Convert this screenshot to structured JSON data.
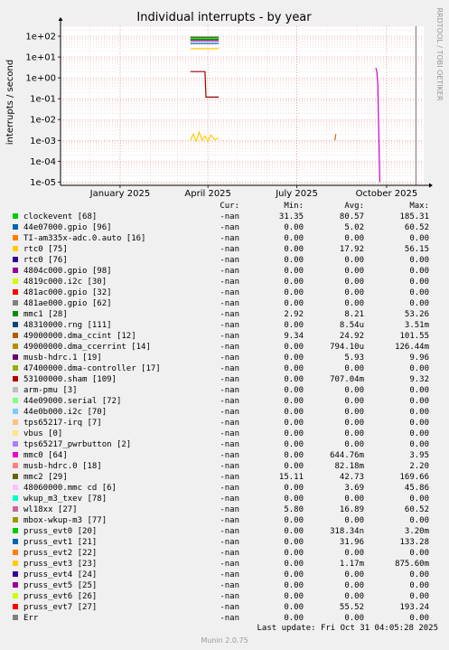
{
  "chart_data": {
    "type": "line",
    "title": "Individual interrupts - by year",
    "ylabel": "interrupts / second",
    "yscale": "log",
    "ylim": [
      7e-06,
      300
    ],
    "yticks": [
      {
        "v": 100,
        "label": "1e+02"
      },
      {
        "v": 10,
        "label": "1e+01"
      },
      {
        "v": 1,
        "label": "1e+00"
      },
      {
        "v": 0.1,
        "label": "1e-01"
      },
      {
        "v": 0.01,
        "label": "1e-02"
      },
      {
        "v": 0.001,
        "label": "1e-03"
      },
      {
        "v": 0.0001,
        "label": "1e-04"
      },
      {
        "v": 1e-05,
        "label": "1e-05"
      }
    ],
    "xlim": [
      "2024-11-01",
      "2025-11-08"
    ],
    "xticks": [
      {
        "d": "2025-01-01",
        "label": "January 2025"
      },
      {
        "d": "2025-04-01",
        "label": "April 2025"
      },
      {
        "d": "2025-07-01",
        "label": "July 2025"
      },
      {
        "d": "2025-10-01",
        "label": "October 2025"
      }
    ],
    "current_date": "2025-10-31",
    "grid": true,
    "side_text": "RRDTOOL / TOBI OETIKER",
    "series": [
      {
        "name": "clockevent [68]",
        "color": "#00cc00",
        "points": [
          [
            "2025-03-14",
            80
          ],
          [
            "2025-04-12",
            80
          ]
        ]
      },
      {
        "name": "44e07000.gpio [96]",
        "color": "#0066b3",
        "points": [
          [
            "2025-03-14",
            45
          ],
          [
            "2025-04-12",
            45
          ]
        ]
      },
      {
        "name": "rtc0 [75]",
        "color": "#ffcc00",
        "points": [
          [
            "2025-03-14",
            25
          ],
          [
            "2025-04-12",
            25
          ]
        ]
      },
      {
        "name": "mmc1 [28]",
        "color": "#008f00",
        "points": [
          [
            "2025-03-14",
            70
          ],
          [
            "2025-04-12",
            70
          ]
        ]
      },
      {
        "name": "musb-hdrc.1 [19]",
        "color": "#990099",
        "points": [
          [
            "2025-03-14",
            60
          ],
          [
            "2025-04-12",
            60
          ]
        ]
      },
      {
        "name": "mmc2 [29]",
        "color": "#336600",
        "points": [
          [
            "2025-03-14",
            90
          ],
          [
            "2025-04-12",
            90
          ]
        ]
      },
      {
        "name": "53100000.sham [109]",
        "color": "#990000",
        "points": [
          [
            "2025-03-14",
            2
          ],
          [
            "2025-03-29",
            2
          ],
          [
            "2025-03-30",
            0.12
          ],
          [
            "2025-04-12",
            0.12
          ]
        ]
      },
      {
        "name": "pruss_evt3 [23]",
        "color": "#ffcc00",
        "points": [
          [
            "2025-03-14",
            0.001
          ],
          [
            "2025-03-17",
            0.002
          ],
          [
            "2025-03-20",
            0.0009
          ],
          [
            "2025-03-23",
            0.0025
          ],
          [
            "2025-03-26",
            0.001
          ],
          [
            "2025-03-29",
            0.0016
          ],
          [
            "2025-04-01",
            0.0009
          ],
          [
            "2025-04-04",
            0.0018
          ],
          [
            "2025-04-08",
            0.0011
          ],
          [
            "2025-04-12",
            0.0013
          ]
        ]
      },
      {
        "name": "mmc0 [64]",
        "color": "#cc00cc",
        "points": [
          [
            "2025-09-20",
            3
          ],
          [
            "2025-09-21",
            2
          ],
          [
            "2025-09-22",
            0.5
          ],
          [
            "2025-09-23",
            0.002
          ],
          [
            "2025-09-24",
            1e-05
          ]
        ]
      },
      {
        "name": "49000000.dma_ccint [12]",
        "color": "#cc6600",
        "points": [
          [
            "2025-08-09",
            0.001
          ],
          [
            "2025-08-10",
            0.002
          ]
        ]
      }
    ]
  },
  "legend": {
    "header": {
      "cur": "Cur:",
      "min": "Min:",
      "avg": "Avg:",
      "max": "Max:"
    },
    "rows": [
      {
        "name": "clockevent [68]",
        "color": "#00cc00",
        "cur": "-nan",
        "min": "31.35",
        "avg": "80.57",
        "max": "185.31"
      },
      {
        "name": "44e07000.gpio [96]",
        "color": "#0066b3",
        "cur": "-nan",
        "min": "0.00",
        "avg": "5.02",
        "max": "60.52"
      },
      {
        "name": "TI-am335x-adc.0.auto [16]",
        "color": "#ff8000",
        "cur": "-nan",
        "min": "0.00",
        "avg": "0.00",
        "max": "0.00"
      },
      {
        "name": "rtc0 [75]",
        "color": "#ffcc00",
        "cur": "-nan",
        "min": "0.00",
        "avg": "17.92",
        "max": "56.15"
      },
      {
        "name": "rtc0 [76]",
        "color": "#330099",
        "cur": "-nan",
        "min": "0.00",
        "avg": "0.00",
        "max": "0.00"
      },
      {
        "name": "4804c000.gpio [98]",
        "color": "#990099",
        "cur": "-nan",
        "min": "0.00",
        "avg": "0.00",
        "max": "0.00"
      },
      {
        "name": "4819c000.i2c [30]",
        "color": "#ccff00",
        "cur": "-nan",
        "min": "0.00",
        "avg": "0.00",
        "max": "0.00"
      },
      {
        "name": "481ac000.gpio [32]",
        "color": "#ff0000",
        "cur": "-nan",
        "min": "0.00",
        "avg": "0.00",
        "max": "0.00"
      },
      {
        "name": "481ae000.gpio [62]",
        "color": "#808080",
        "cur": "-nan",
        "min": "0.00",
        "avg": "0.00",
        "max": "0.00"
      },
      {
        "name": "mmc1 [28]",
        "color": "#008f00",
        "cur": "-nan",
        "min": "2.92",
        "avg": "8.21",
        "max": "53.26"
      },
      {
        "name": "48310000.rng [111]",
        "color": "#00487d",
        "cur": "-nan",
        "min": "0.00",
        "avg": "8.54u",
        "max": "3.51m"
      },
      {
        "name": "49000000.dma_ccint [12]",
        "color": "#b35a00",
        "cur": "-nan",
        "min": "9.34",
        "avg": "24.92",
        "max": "101.55"
      },
      {
        "name": "49000000.dma_ccerrint [14]",
        "color": "#b38f00",
        "cur": "-nan",
        "min": "0.00",
        "avg": "794.10u",
        "max": "126.44m"
      },
      {
        "name": "musb-hdrc.1 [19]",
        "color": "#6b006b",
        "cur": "-nan",
        "min": "0.00",
        "avg": "5.93",
        "max": "9.96"
      },
      {
        "name": "47400000.dma-controller [17]",
        "color": "#8fb300",
        "cur": "-nan",
        "min": "0.00",
        "avg": "0.00",
        "max": "0.00"
      },
      {
        "name": "53100000.sham [109]",
        "color": "#b30000",
        "cur": "-nan",
        "min": "0.00",
        "avg": "707.04m",
        "max": "9.32"
      },
      {
        "name": "arm-pmu [3]",
        "color": "#bebebe",
        "cur": "-nan",
        "min": "0.00",
        "avg": "0.00",
        "max": "0.00"
      },
      {
        "name": "44e09000.serial [72]",
        "color": "#80ff80",
        "cur": "-nan",
        "min": "0.00",
        "avg": "0.00",
        "max": "0.00"
      },
      {
        "name": "44e0b000.i2c [70]",
        "color": "#80c9ff",
        "cur": "-nan",
        "min": "0.00",
        "avg": "0.00",
        "max": "0.00"
      },
      {
        "name": "tps65217-irq [7]",
        "color": "#ffc080",
        "cur": "-nan",
        "min": "0.00",
        "avg": "0.00",
        "max": "0.00"
      },
      {
        "name": "vbus [0]",
        "color": "#ffe680",
        "cur": "-nan",
        "min": "0.00",
        "avg": "0.00",
        "max": "0.00"
      },
      {
        "name": "tps65217_pwrbutton [2]",
        "color": "#aa80ff",
        "cur": "-nan",
        "min": "0.00",
        "avg": "0.00",
        "max": "0.00"
      },
      {
        "name": "mmc0 [64]",
        "color": "#ee00cc",
        "cur": "-nan",
        "min": "0.00",
        "avg": "644.76m",
        "max": "3.95"
      },
      {
        "name": "musb-hdrc.0 [18]",
        "color": "#ff8080",
        "cur": "-nan",
        "min": "0.00",
        "avg": "82.18m",
        "max": "2.20"
      },
      {
        "name": "mmc2 [29]",
        "color": "#666600",
        "cur": "-nan",
        "min": "15.11",
        "avg": "42.73",
        "max": "169.66"
      },
      {
        "name": "48060000.mmc cd [6]",
        "color": "#ffbfff",
        "cur": "-nan",
        "min": "0.00",
        "avg": "3.69",
        "max": "45.86"
      },
      {
        "name": "wkup_m3_txev [78]",
        "color": "#00ffcc",
        "cur": "-nan",
        "min": "0.00",
        "avg": "0.00",
        "max": "0.00"
      },
      {
        "name": "wl18xx [27]",
        "color": "#cc6699",
        "cur": "-nan",
        "min": "5.80",
        "avg": "16.89",
        "max": "60.52"
      },
      {
        "name": "mbox-wkup-m3 [77]",
        "color": "#999900",
        "cur": "-nan",
        "min": "0.00",
        "avg": "0.00",
        "max": "0.00"
      },
      {
        "name": "pruss_evt0 [20]",
        "color": "#00cc00",
        "cur": "-nan",
        "min": "0.00",
        "avg": "318.34n",
        "max": "3.20m"
      },
      {
        "name": "pruss_evt1 [21]",
        "color": "#0066b3",
        "cur": "-nan",
        "min": "0.00",
        "avg": "31.96",
        "max": "133.28"
      },
      {
        "name": "pruss_evt2 [22]",
        "color": "#ff8000",
        "cur": "-nan",
        "min": "0.00",
        "avg": "0.00",
        "max": "0.00"
      },
      {
        "name": "pruss_evt3 [23]",
        "color": "#ffcc00",
        "cur": "-nan",
        "min": "0.00",
        "avg": "1.17m",
        "max": "875.60m"
      },
      {
        "name": "pruss_evt4 [24]",
        "color": "#330099",
        "cur": "-nan",
        "min": "0.00",
        "avg": "0.00",
        "max": "0.00"
      },
      {
        "name": "pruss_evt5 [25]",
        "color": "#990099",
        "cur": "-nan",
        "min": "0.00",
        "avg": "0.00",
        "max": "0.00"
      },
      {
        "name": "pruss_evt6 [26]",
        "color": "#ccff00",
        "cur": "-nan",
        "min": "0.00",
        "avg": "0.00",
        "max": "0.00"
      },
      {
        "name": "pruss_evt7 [27]",
        "color": "#ff0000",
        "cur": "-nan",
        "min": "0.00",
        "avg": "55.52",
        "max": "193.24"
      },
      {
        "name": "Err",
        "color": "#808080",
        "cur": "-nan",
        "min": "0.00",
        "avg": "0.00",
        "max": "0.00"
      }
    ]
  },
  "last_update": "Last update: Fri Oct 31 04:05:28 2025",
  "munin_version": "Munin 2.0.75"
}
